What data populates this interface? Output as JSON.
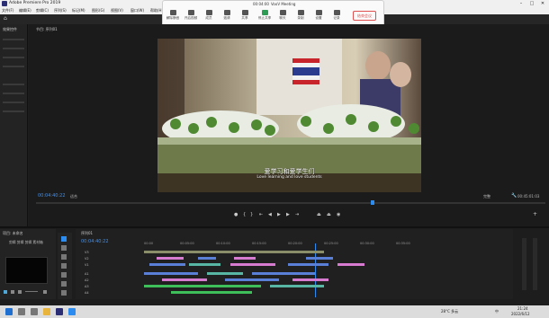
{
  "window": {
    "title": "Adobe Premiere Pro 2019"
  },
  "menu": [
    "文件(F)",
    "编辑(E)",
    "剪辑(C)",
    "序列(S)",
    "标记(M)",
    "图形(G)",
    "视图(V)",
    "窗口(W)",
    "帮助(H)"
  ],
  "meeting": {
    "time": "00:04:00",
    "title": "VooV Meeting",
    "tools": [
      "解除静音",
      "开启视频",
      "成员",
      "邀请",
      "共享",
      "停止共享",
      "聊天",
      "录制",
      "设置",
      "记录",
      "应用"
    ],
    "end_label": "结束会议"
  },
  "left_panel": {
    "tab": "效果控件"
  },
  "program": {
    "tab": "节目: 序列01",
    "timecode_in": "00:04:40:22",
    "fit": "适合",
    "quality": "完整",
    "timecode_out": "00:45:01:03",
    "caption_cn": "爱学习和爱学生们",
    "caption_en": "Love learning and love students"
  },
  "project": {
    "tab": "项目: 未命名",
    "path": "剪辑 剪辑 剪辑 素材箱"
  },
  "timeline": {
    "tab": "序列01",
    "timecode": "00:04:40:22",
    "ruler": [
      "00:00",
      "00:05:00",
      "00:10:00",
      "00:15:00",
      "00:20:00",
      "00:25:00",
      "00:30:00",
      "00:35:00"
    ],
    "tracks": [
      "V3",
      "V2",
      "V1",
      "A1",
      "A2",
      "A3",
      "A4"
    ]
  },
  "taskbar": {
    "weather": "28°C 多云",
    "lang": "中",
    "time": "21:24",
    "date": "2022/6/12"
  },
  "colors": {
    "accent": "#2d8cf0",
    "clip_pink": "#d77bd1",
    "clip_teal": "#58b7a4",
    "clip_blue": "#5a7fd6",
    "clip_green": "#3fbf5a"
  }
}
